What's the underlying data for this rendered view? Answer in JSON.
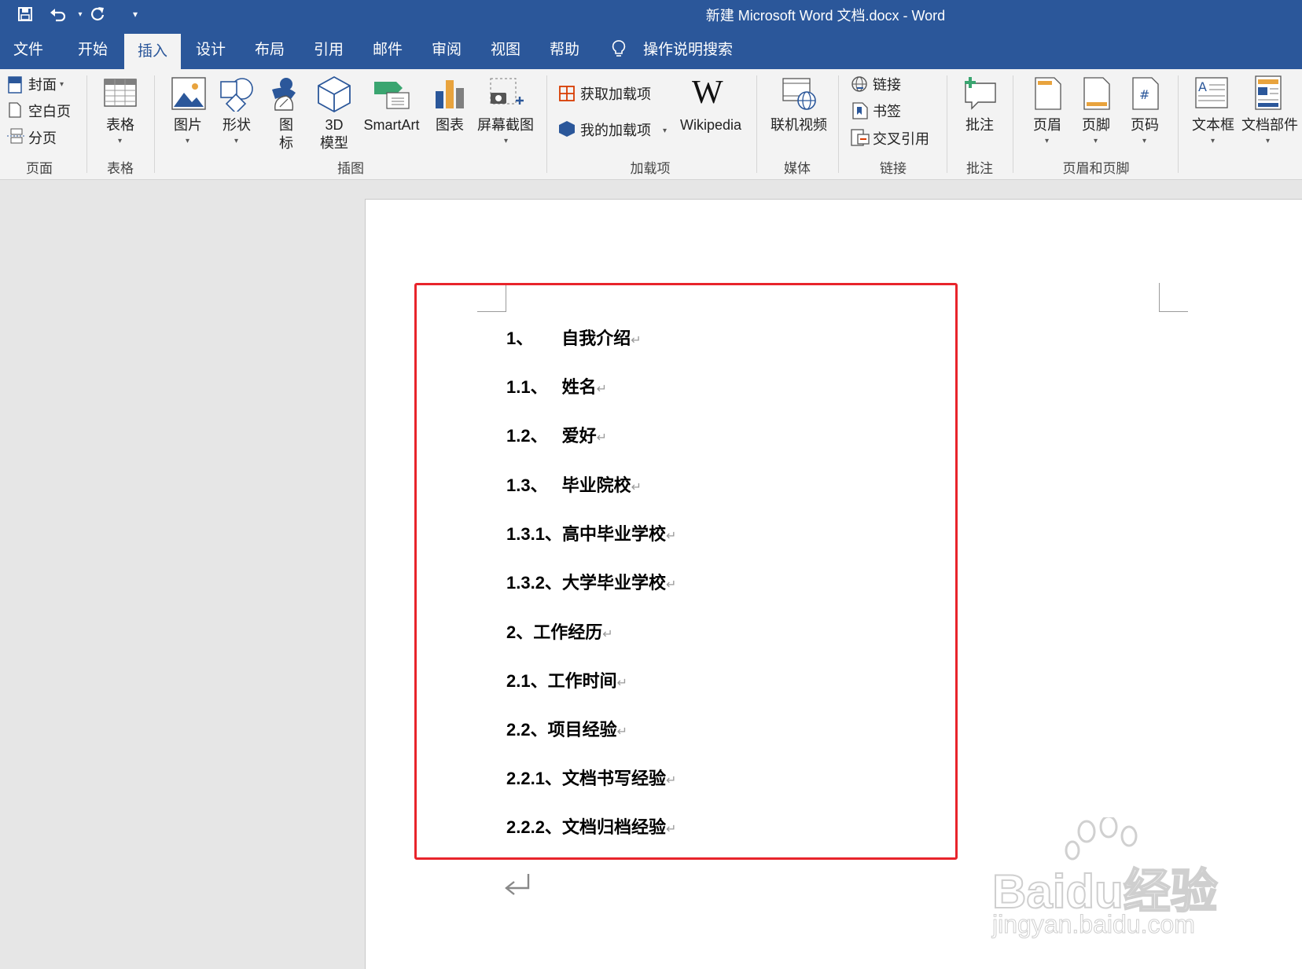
{
  "window": {
    "title": "新建 Microsoft Word 文档.docx  -  Word"
  },
  "qat": {
    "save_icon": "save-icon",
    "undo_icon": "undo-icon",
    "redo_icon": "redo-icon",
    "customize_icon": "customize-qat-icon"
  },
  "tabs": [
    {
      "label": "文件"
    },
    {
      "label": "开始"
    },
    {
      "label": "插入"
    },
    {
      "label": "设计"
    },
    {
      "label": "布局"
    },
    {
      "label": "引用"
    },
    {
      "label": "邮件"
    },
    {
      "label": "审阅"
    },
    {
      "label": "视图"
    },
    {
      "label": "帮助"
    }
  ],
  "active_tab": "插入",
  "tell_me": "操作说明搜索",
  "ribbon": {
    "pages": {
      "cover": "封面",
      "blank": "空白页",
      "break": "分页",
      "group": "页面"
    },
    "tables": {
      "table": "表格",
      "group": "表格"
    },
    "illustrations": {
      "pictures": "图片",
      "shapes": "形状",
      "icons_1": "图",
      "icons_2": "标",
      "model_1": "3D",
      "model_2": "模型",
      "smartart": "SmartArt",
      "chart": "图表",
      "screenshot": "屏幕截图",
      "group": "插图"
    },
    "addins": {
      "get": "获取加载项",
      "mine": "我的加载项",
      "wikipedia": "Wikipedia",
      "group": "加载项"
    },
    "media": {
      "video": "联机视频",
      "group": "媒体"
    },
    "links": {
      "link": "链接",
      "bookmark": "书签",
      "crossref": "交叉引用",
      "group": "链接"
    },
    "comments": {
      "comment": "批注",
      "group": "批注"
    },
    "header_footer": {
      "header": "页眉",
      "footer": "页脚",
      "page_number": "页码",
      "group": "页眉和页脚"
    },
    "text": {
      "textbox": "文本框",
      "quickparts": "文档部件"
    }
  },
  "document": {
    "toc": [
      {
        "num": "1、",
        "text": "自我介绍"
      },
      {
        "num": "1.1、",
        "text": "姓名"
      },
      {
        "num": "1.2、",
        "text": "爱好"
      },
      {
        "num": "1.3、",
        "text": "毕业院校"
      },
      {
        "num": "1.3.1、",
        "text": "高中毕业学校"
      },
      {
        "num": "1.3.2、",
        "text": "大学毕业学校"
      },
      {
        "num": "2、",
        "text": "工作经历"
      },
      {
        "num": "2.1、",
        "text": "工作时间"
      },
      {
        "num": "2.2、",
        "text": "项目经验"
      },
      {
        "num": "2.2.1、",
        "text": "文档书写经验"
      },
      {
        "num": "2.2.2、",
        "text": "文档归档经验"
      }
    ],
    "paragraph_mark": "↵",
    "highlight_color": "#e8242b"
  },
  "watermark": {
    "brand": "Bai",
    "brand2": "du",
    "cn": "经验",
    "url": "jingyan.baidu.com"
  },
  "colors": {
    "word_blue": "#2b579a",
    "ribbon_bg": "#f3f3f3",
    "workspace": "#e6e6e6"
  }
}
